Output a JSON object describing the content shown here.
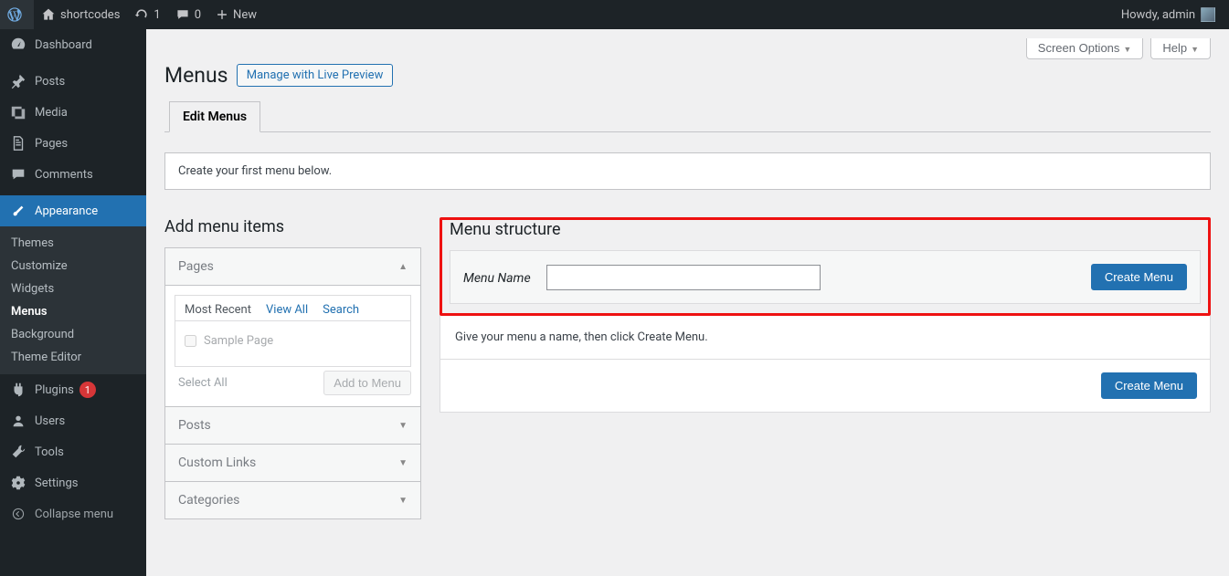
{
  "adminbar": {
    "site_name": "shortcodes",
    "updates_count": "1",
    "comments_count": "0",
    "new_label": "New",
    "howdy": "Howdy, admin"
  },
  "sidebar": {
    "items": [
      {
        "icon": "dashboard",
        "label": "Dashboard"
      },
      {
        "icon": "pin",
        "label": "Posts"
      },
      {
        "icon": "media",
        "label": "Media"
      },
      {
        "icon": "page",
        "label": "Pages"
      },
      {
        "icon": "comment",
        "label": "Comments"
      },
      {
        "icon": "appearance",
        "label": "Appearance"
      },
      {
        "icon": "plugin",
        "label": "Plugins"
      },
      {
        "icon": "user",
        "label": "Users"
      },
      {
        "icon": "tool",
        "label": "Tools"
      },
      {
        "icon": "settings",
        "label": "Settings"
      }
    ],
    "appearance_sub": [
      "Themes",
      "Customize",
      "Widgets",
      "Menus",
      "Background",
      "Theme Editor"
    ],
    "plugins_badge": "1",
    "collapse_label": "Collapse menu"
  },
  "screen_meta": {
    "screen_options": "Screen Options",
    "help": "Help"
  },
  "page": {
    "title": "Menus",
    "manage_link": "Manage with Live Preview",
    "tab_edit": "Edit Menus",
    "notice": "Create your first menu below."
  },
  "add_items": {
    "heading": "Add menu items",
    "panels": {
      "pages": "Pages",
      "posts": "Posts",
      "custom": "Custom Links",
      "categories": "Categories"
    },
    "pages_tabs": {
      "recent": "Most Recent",
      "viewall": "View All",
      "search": "Search"
    },
    "sample_page": "Sample Page",
    "select_all": "Select All",
    "add_to_menu": "Add to Menu"
  },
  "structure": {
    "heading": "Menu structure",
    "menu_name_label": "Menu Name",
    "create_menu": "Create Menu",
    "instruction": "Give your menu a name, then click Create Menu."
  }
}
